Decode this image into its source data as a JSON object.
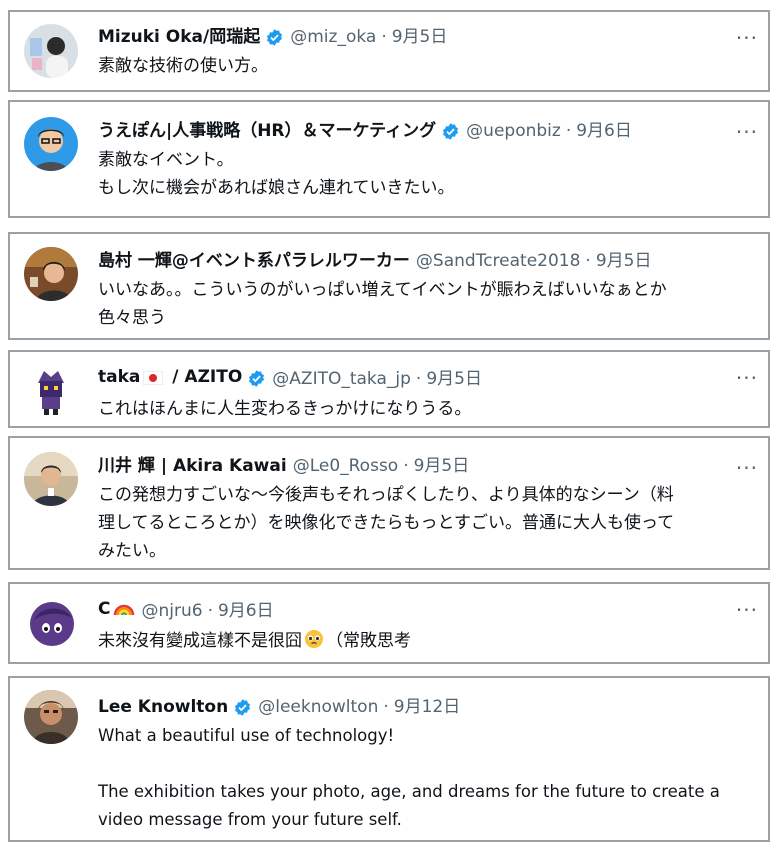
{
  "tweets": [
    {
      "name": "Mizuki Oka/岡瑞起",
      "verified": true,
      "handle": "@miz_oka",
      "date": "9月5日",
      "text": "素敵な技術の使い方。"
    },
    {
      "name": "うえぽん|人事戦略（HR）＆マーケティング",
      "verified": true,
      "handle": "@ueponbiz",
      "date": "9月6日",
      "text": "素敵なイベント。\nもし次に機会があれば娘さん連れていきたい。"
    },
    {
      "name": "島村 一輝@イベント系パラレルワーカー",
      "verified": false,
      "handle": "@SandTcreate2018",
      "date": "9月5日",
      "text": "いいなあ。。こういうのがいっぱい増えてイベントが賑わえばいいなぁとか\n色々思う"
    },
    {
      "name_prefix": "taka",
      "name_flag": "japan-flag-icon",
      "name_suffix": " / AZITO",
      "verified": true,
      "handle": "@AZITO_taka_jp",
      "date": "9月5日",
      "text": "これはほんまに人生変わるきっかけになりうる。"
    },
    {
      "name": "川井 輝 | Akira Kawai",
      "verified": false,
      "handle": "@Le0_Rosso",
      "date": "9月5日",
      "text": "この発想力すごいな〜今後声もそれっぽくしたり、より具体的なシーン（料\n理してるところとか）を映像化できたらもっとすごい。普通に大人も使って\nみたい。"
    },
    {
      "name_prefix": "C",
      "name_emoji": "rainbow-icon",
      "verified": false,
      "handle": "@njru6",
      "date": "9月6日",
      "text_prefix": "未來沒有變成這樣不是很囧",
      "text_emoji": "pleading-face-icon",
      "text_suffix": "（常敗思考"
    },
    {
      "name": "Lee Knowlton",
      "verified": true,
      "handle": "@leeknowlton",
      "date": "9月12日",
      "text": "What a beautiful use of technology!\n\nThe exhibition takes your photo, age, and dreams for the future to create a\nvideo message from your future self."
    }
  ],
  "more_label": "···",
  "separator": "·",
  "colors": {
    "verified": "#1d9bf0",
    "secondary_text": "#536471",
    "border": "#9aa0a6"
  }
}
